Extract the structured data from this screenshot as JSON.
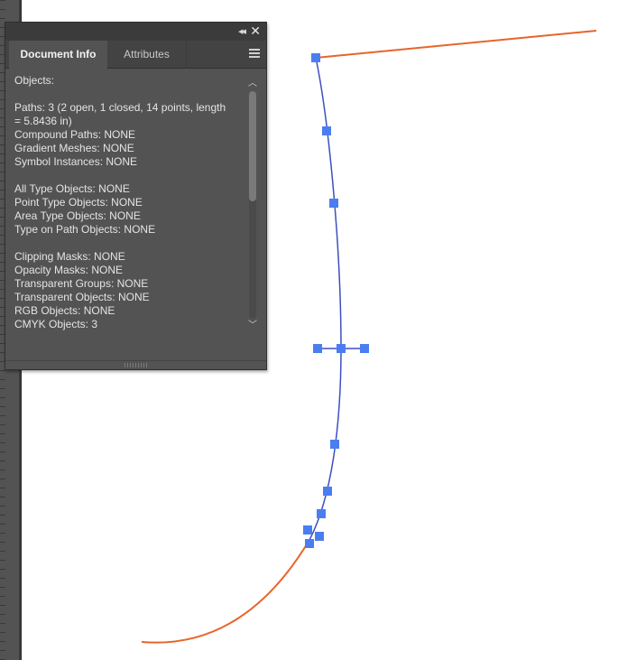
{
  "panel": {
    "tabs": [
      {
        "label": "Document Info",
        "active": true
      },
      {
        "label": "Attributes",
        "active": false
      }
    ],
    "collapse_glyph": "◂◂",
    "close_glyph": "✕",
    "icons": {
      "collapse": "double-chevron-left-icon",
      "close": "close-icon",
      "menu": "hamburger-menu-icon",
      "scroll_up": "chevron-up-icon",
      "scroll_down": "chevron-down-icon"
    },
    "lines": [
      "Objects:",
      "",
      "Paths: 3 (2 open, 1 closed, 14 points, length = 5.8436 in)",
      "Compound Paths: NONE",
      "Gradient Meshes: NONE",
      "Symbol Instances: NONE",
      "",
      "All Type Objects: NONE",
      "Point Type Objects: NONE",
      "Area Type Objects: NONE",
      "Type on Path Objects: NONE",
      "",
      "Clipping Masks: NONE",
      "Opacity Masks: NONE",
      "Transparent Groups: NONE",
      "Transparent Objects: NONE",
      "RGB Objects: NONE",
      "CMYK Objects: 3"
    ],
    "scroll_position": 0.0
  },
  "colors": {
    "orange_stroke": "#e8642b",
    "selected_path": "#3d4fc0",
    "anchor_fill": "#4a7ef0"
  }
}
